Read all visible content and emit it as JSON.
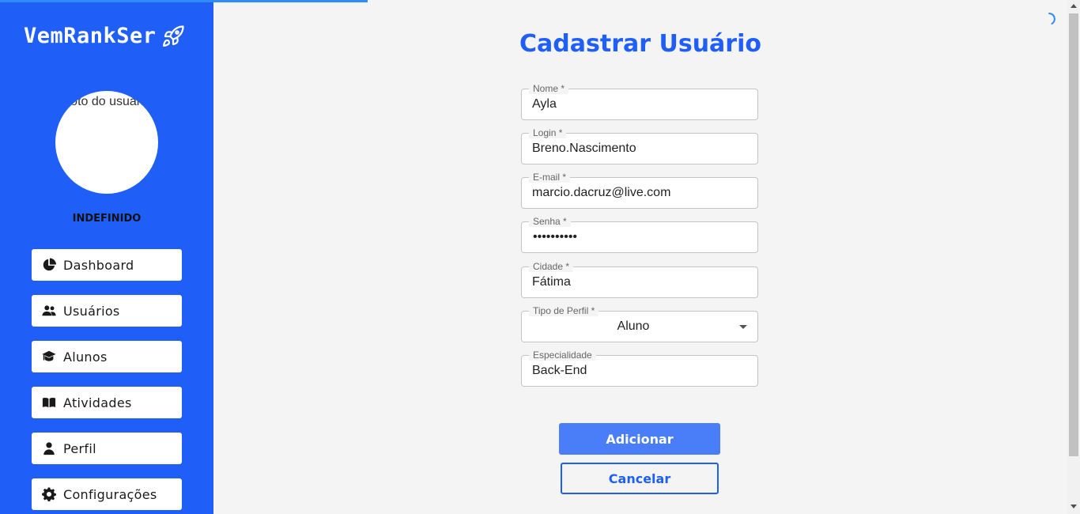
{
  "app": {
    "name": "VemRankSer"
  },
  "sidebar": {
    "avatar_alt": "Foto do usuário",
    "user_name": "INDEFINIDO",
    "items": [
      {
        "label": "Dashboard",
        "icon": "pie-chart-icon"
      },
      {
        "label": "Usuários",
        "icon": "users-icon"
      },
      {
        "label": "Alunos",
        "icon": "graduation-cap-icon"
      },
      {
        "label": "Atividades",
        "icon": "book-icon"
      },
      {
        "label": "Perfil",
        "icon": "person-icon"
      },
      {
        "label": "Configurações",
        "icon": "gear-icon"
      }
    ]
  },
  "form": {
    "title": "Cadastrar Usuário",
    "fields": {
      "nome": {
        "label": "Nome *",
        "value": "Ayla"
      },
      "login": {
        "label": "Login *",
        "value": "Breno.Nascimento"
      },
      "email": {
        "label": "E-mail *",
        "value": "marcio.dacruz@live.com"
      },
      "senha": {
        "label": "Senha *",
        "value": "••••••••••"
      },
      "cidade": {
        "label": "Cidade *",
        "value": "Fátima"
      },
      "tipo_perfil": {
        "label": "Tipo de Perfil *",
        "value": "Aluno"
      },
      "especialidade": {
        "label": "Especialidade",
        "value": "Back-End"
      }
    },
    "submit_label": "Adicionar",
    "cancel_label": "Cancelar"
  },
  "colors": {
    "primary": "#1f5ff8",
    "button": "#4a7ef9",
    "background": "#f4f4f4",
    "progress": "#2f8bf6"
  }
}
